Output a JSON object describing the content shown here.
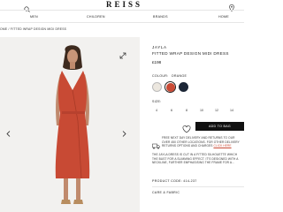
{
  "header": {
    "logo": "REISS",
    "nav": [
      "MEN",
      "CHILDREN",
      "BRANDS",
      "HOME"
    ]
  },
  "breadcrumb": "OME  /  FITTED WRAP DESIGN MIDI DRESS",
  "product": {
    "brand": "JAYLA",
    "name": "FITTED WRAP DESIGN MIDI DRESS",
    "price": "£198",
    "colour_label": "COLOUR:",
    "colour_value": "ORANGE",
    "swatches": [
      "#ece7df",
      "#c94a35",
      "#1c2636"
    ],
    "size_label": "SIZE:",
    "sizes": [
      "4",
      "6",
      "8",
      "10",
      "12",
      "14"
    ],
    "add_to_bag": "ADD TO BAG",
    "delivery_text": [
      "FREE NEXT DAY DELIVERY AND RETURNS TO OUR",
      "OVER 450 OTHER LOCATIONS. FOR OTHER DELIVERY",
      "RETURNS OPTIONS AND CHARGES"
    ],
    "delivery_link": "CLICK HERE",
    "description": [
      "THE JAYLA DRESS IS CUT IN A FITTED SILHOUETTE WHICH",
      "THE BUST FOR A SLIMMING EFFECT. IT'S DESIGNED WITH A",
      "NECKLINE, FURTHER EMPHASISING THE FRAME FOR A..."
    ],
    "product_code": "PRODUCT CODE:  414-237",
    "care": "CARE & FABRIC"
  },
  "colors": {
    "accent": "#c94a35",
    "button": "#111111",
    "link": "#c94a35"
  },
  "icons": [
    "search-icon",
    "location-icon",
    "expand-icon",
    "chevron-left-icon",
    "chevron-right-icon",
    "heart-icon",
    "truck-icon"
  ]
}
